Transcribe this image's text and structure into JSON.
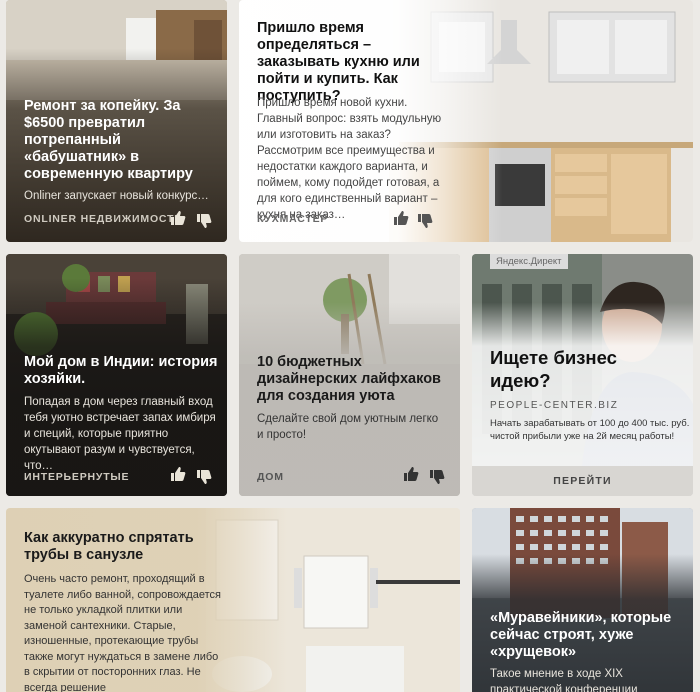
{
  "cards": [
    {
      "title": "Ремонт за копейку. За $6500 превратил потрепанный «бабушатник» в современную квартиру",
      "snippet": "Onliner запускает новый конкурс…",
      "source": "ONLINER НЕДВИЖИМОСТЬ"
    },
    {
      "title": "Пришло время определяться – заказывать кухню или пойти и купить. Как поступить?",
      "snippet": "Пришло время новой кухни. Главный вопрос: взять модульную или изготовить на заказ? Рассмотрим все преимущества и недостатки каждого варианта, и поймем, кому подойдет готовая, а для кого единственный вариант – кухня на заказ…",
      "source": "КУХМАСТЕР"
    },
    {
      "title": "Мой дом в Индии: история хозяйки.",
      "snippet": "Попадая в дом через главный вход тебя уютно встречает запах имбиря и специй, которые приятно окутывают разум и чувствуется, что…",
      "source": "ИНТЕРЬЕРНУТЫЕ"
    },
    {
      "title": "10 бюджетных дизайнерских лайфхаков для создания уюта",
      "snippet": "Сделайте свой дом уютным легко и просто!",
      "source": "ДОМ"
    },
    {
      "title": "Как аккуратно спрятать трубы в санузле",
      "snippet": "Очень часто ремонт, проходящий в туалете либо ванной, сопровождается не только укладкой плитки или заменой сантехники. Старые, изношенные, протекающие трубы также могут нуждаться в замене либо в скрытии от посторонних глаз. Не всегда решение"
    },
    {
      "title": "«Муравейники», которые сейчас строят, хуже «хрущевок»",
      "snippet": "Такое мнение в ходе XIX практической конференции"
    }
  ],
  "ad": {
    "badge": "Яндекс.Директ",
    "title": "Ищете бизнес идею?",
    "domain": "PEOPLE-CENTER.BIZ",
    "text": "Начать зарабатывать от 100 до 400 тыс. руб. чистой прибыли уже на 2й месяц работы!",
    "button": "ПЕРЕЙТИ"
  },
  "colors": {
    "page_bg": "#eceae6",
    "dark_shade": "#1c1814",
    "light_shade": "#ffffff",
    "ad_button": "#d8d6d2"
  }
}
